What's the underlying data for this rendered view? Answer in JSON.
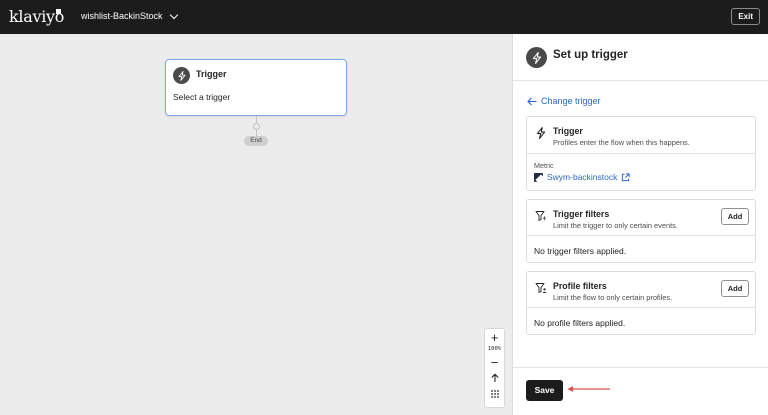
{
  "topbar": {
    "logo_text": "klaviyo",
    "flow_name": "wishlist-BackinStock",
    "exit_label": "Exit"
  },
  "canvas": {
    "trigger_node": {
      "title": "Trigger",
      "subtitle": "Select a trigger",
      "icon": "lightning-icon"
    },
    "end_label": "End",
    "zoom": {
      "zoom_in": "+",
      "level": "100%",
      "zoom_out": "−"
    }
  },
  "panel": {
    "title": "Set up trigger",
    "change_trigger_label": "Change trigger",
    "trigger_card": {
      "title": "Trigger",
      "subtitle": "Profiles enter the flow when this happens.",
      "metric_label": "Metric",
      "metric_value": "Swym-backinstock"
    },
    "trigger_filters_card": {
      "title": "Trigger filters",
      "subtitle": "Limit the trigger to only certain events.",
      "add_label": "Add",
      "empty_text": "No trigger filters applied."
    },
    "profile_filters_card": {
      "title": "Profile filters",
      "subtitle": "Limit the flow to only certain profiles.",
      "add_label": "Add",
      "empty_text": "No profile filters applied."
    },
    "save_label": "Save"
  },
  "colors": {
    "topbar_bg": "#1c1c1c",
    "canvas_bg": "#ececec",
    "link_blue": "#2c68c2",
    "node_border": "#7aa7e0",
    "annotation_arrow": "#d9534f"
  }
}
